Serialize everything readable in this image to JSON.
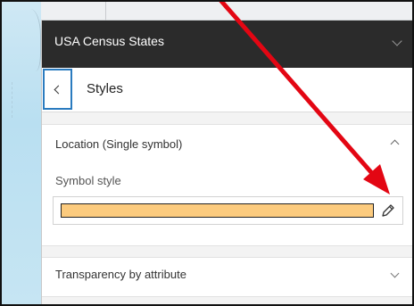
{
  "layer_panel": {
    "title": "USA Census States"
  },
  "styles_row": {
    "back_label": "<",
    "label": "Styles"
  },
  "location_section": {
    "title": "Location (Single symbol)",
    "field_label": "Symbol style",
    "symbol_fill_color": "#fccb7e",
    "edit_icon": "pencil-icon"
  },
  "transparency_section": {
    "title": "Transparency by attribute"
  },
  "annotation": {
    "arrow_color": "#e30613"
  }
}
